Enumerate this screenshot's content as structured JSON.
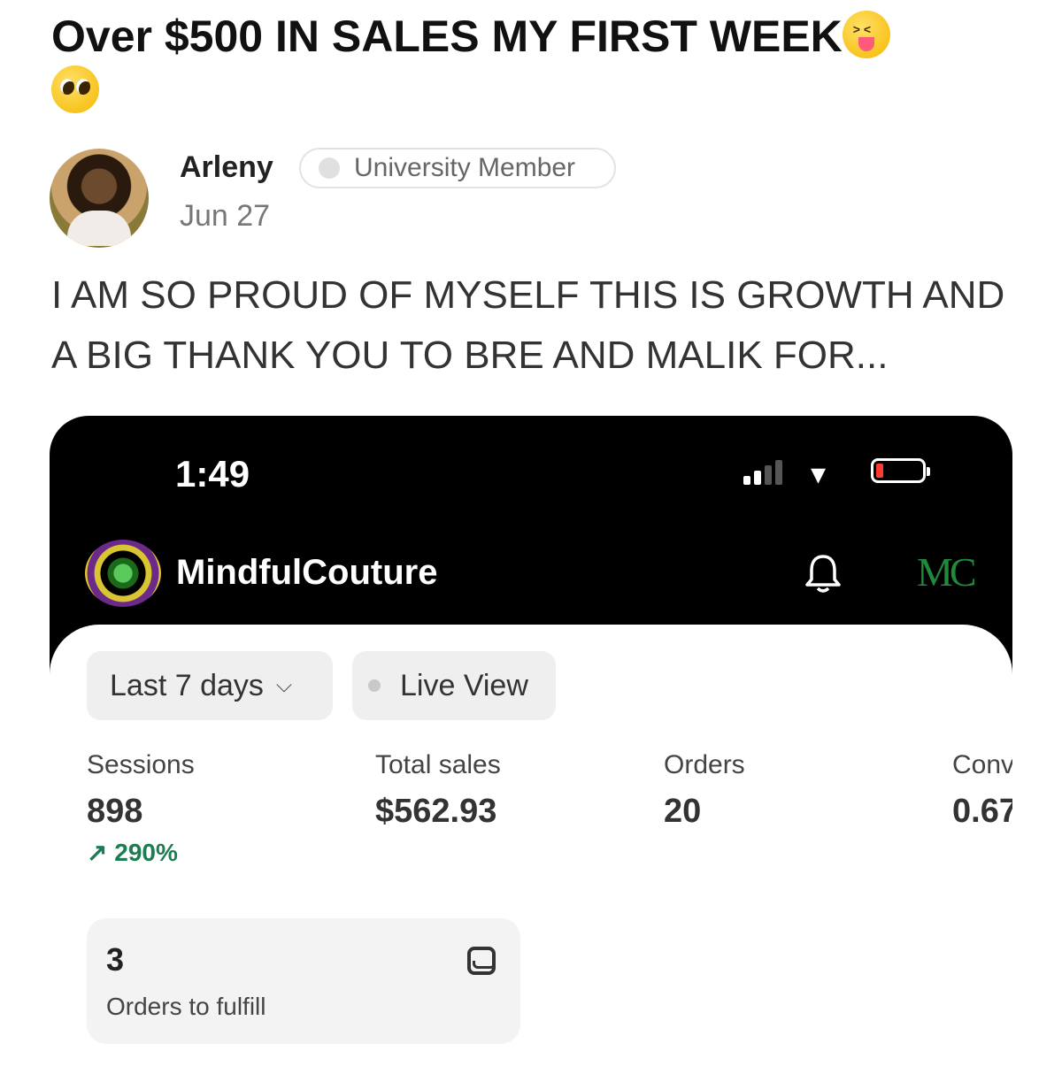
{
  "post": {
    "title": "Over $500 IN SALES MY FIRST WEEK",
    "title_emojis": [
      "squinting-face-with-tongue-icon",
      "pleading-face-icon"
    ],
    "author": "Arleny",
    "badge": "University Member",
    "date": "Jun 27",
    "body": "I AM SO PROUD OF MYSELF THIS IS GROWTH AND A BIG THANK YOU TO BRE AND MALIK FOR..."
  },
  "phone": {
    "time": "1:49",
    "store_name": "MindfulCouture",
    "store_initials": "MC",
    "period_label": "Last 7 days",
    "live_label": "Live View",
    "metrics": [
      {
        "label": "Sessions",
        "value": "898",
        "change": "290%"
      },
      {
        "label": "Total sales",
        "value": "$562.93"
      },
      {
        "label": "Orders",
        "value": "20"
      },
      {
        "label": "Conv",
        "value": "0.67"
      }
    ],
    "fulfill": {
      "count": "3",
      "label": "Orders to fulfill"
    },
    "colors": {
      "accent_green": "#1d7d52",
      "battery_low": "#ff3b30"
    }
  }
}
